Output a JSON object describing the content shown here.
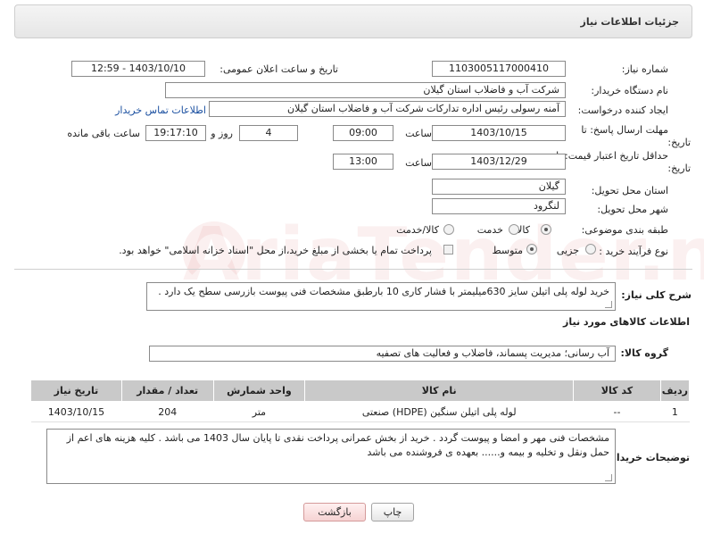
{
  "header": {
    "title": "جزئیات اطلاعات نیاز"
  },
  "form": {
    "need_number": {
      "label": "شماره نیاز:",
      "value": "1103005117000410"
    },
    "announce_datetime": {
      "label": "تاریخ و ساعت اعلان عمومی:",
      "value": "1403/10/10 - 12:59"
    },
    "buyer_org": {
      "label": "نام دستگاه خریدار:",
      "value": "شرکت آب و فاضلاب استان گیلان"
    },
    "requester": {
      "label": "ایجاد کننده درخواست:",
      "value": "آمنه رسولی رئیس اداره تدارکات شرکت آب و فاضلاب استان گیلان",
      "contact_link": "اطلاعات تماس خریدار"
    },
    "reply_deadline": {
      "label_line1": "مهلت ارسال پاسخ: تا",
      "label_line2": "تاریخ:",
      "date": "1403/10/15",
      "time_label": "ساعت",
      "time": "09:00",
      "days": "4",
      "days_label": "روز و",
      "remaining": "19:17:10",
      "remaining_label": "ساعت باقی مانده"
    },
    "price_validity": {
      "label_line1": "حداقل تاریخ اعتبار قیمت: تا",
      "label_line2": "تاریخ:",
      "date": "1403/12/29",
      "time_label": "ساعت",
      "time": "13:00"
    },
    "delivery_province": {
      "label": "استان محل تحویل:",
      "value": "گیلان"
    },
    "delivery_city": {
      "label": "شهر محل تحویل:",
      "value": "لنگرود"
    },
    "category": {
      "label": "طبقه بندی موضوعی:",
      "options": [
        "کالا",
        "خدمت",
        "کالا/خدمت"
      ],
      "selected": "کالا"
    },
    "process_type": {
      "label": "نوع فرآیند خرید :",
      "options": [
        "جزیی",
        "متوسط"
      ],
      "selected": "متوسط",
      "payment_note": "پرداخت تمام یا بخشی از مبلغ خرید،از محل \"اسناد خزانه اسلامی\" خواهد بود."
    }
  },
  "description": {
    "label": "شرح کلی نیاز:",
    "value": "خرید لوله پلی اتیلن سایز 630میلیمتر با فشار کاری 10 بارطبق مشخصات فنی پیوست بازرسی سطح یک دارد ."
  },
  "goods": {
    "section_title": "اطلاعات کالاهای مورد نیاز",
    "group_label": "گروه کالا:",
    "group_value": "آب رسانی؛ مدیریت پسماند، فاضلاب و فعالیت های تصفیه",
    "columns": [
      "ردیف",
      "کد کالا",
      "نام کالا",
      "واحد شمارش",
      "تعداد / مقدار",
      "تاریخ نیاز"
    ],
    "rows": [
      [
        "1",
        "--",
        "لوله پلی اتیلن سنگین (HDPE) صنعتی",
        "متر",
        "204",
        "1403/10/15"
      ]
    ]
  },
  "buyer_notes": {
    "label": "توضیحات خریدار:",
    "value": "مشخصات فنی مهر و امضا و پیوست گردد . خرید از بخش عمرانی پرداخت نقدی تا پایان سال 1403 می باشد . کلیه هزینه های اعم از حمل ونقل و تخلیه و بیمه و...... بعهده ی فروشنده می باشد"
  },
  "buttons": {
    "print": "چاپ",
    "back": "بازگشت"
  },
  "watermark": {
    "text": "AriaTender.neT"
  },
  "colors": {
    "header_bg": "#e9e9e9",
    "table_header": "#c9c9c9",
    "back_button_bg": "#fbe1e1",
    "link": "#1a4fa0"
  }
}
